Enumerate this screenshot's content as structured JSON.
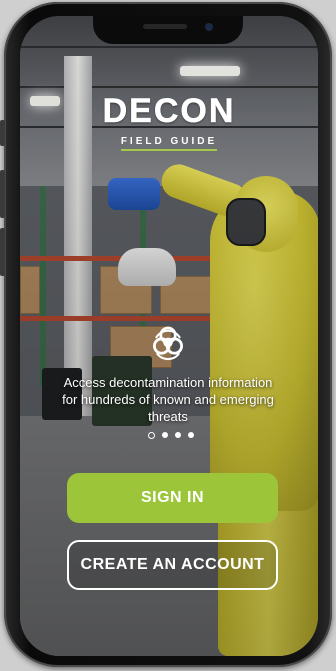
{
  "logo": {
    "main": "DECON",
    "sub": "FIELD GUIDE"
  },
  "icons": {
    "biohazard": "biohazard-icon"
  },
  "tagline": "Access decontamination information for hundreds of known and emerging threats",
  "pager": {
    "count": 4,
    "active_index": 0
  },
  "buttons": {
    "sign_in": "SIGN IN",
    "create_account": "CREATE AN ACCOUNT"
  },
  "colors": {
    "accent": "#9cc53a",
    "button_text": "#ffffff",
    "outline": "#ffffff"
  }
}
